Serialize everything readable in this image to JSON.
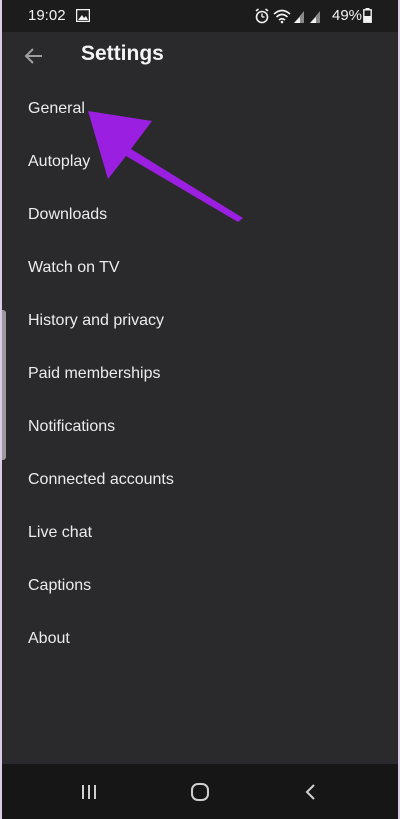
{
  "status_bar": {
    "time": "19:02",
    "battery_percent": "49%",
    "icons": [
      "gallery-icon",
      "alarm-icon",
      "wifi-icon",
      "signal-icon",
      "signal-icon",
      "battery-icon"
    ]
  },
  "app_bar": {
    "title": "Settings",
    "back_icon": "arrow-left-icon"
  },
  "settings": {
    "items": [
      {
        "label": "General"
      },
      {
        "label": "Autoplay"
      },
      {
        "label": "Downloads"
      },
      {
        "label": "Watch on TV"
      },
      {
        "label": "History and privacy"
      },
      {
        "label": "Paid memberships"
      },
      {
        "label": "Notifications"
      },
      {
        "label": "Connected accounts"
      },
      {
        "label": "Live chat"
      },
      {
        "label": "Captions"
      },
      {
        "label": "About"
      }
    ]
  },
  "annotation": {
    "arrow_color": "#9b1fe0",
    "points_to": "General"
  },
  "nav_bar": {
    "icons": [
      "recent-apps-icon",
      "home-icon",
      "back-icon"
    ]
  },
  "colors": {
    "background": "#2a2a2c",
    "status_bar": "#1c1c1d",
    "nav_bar": "#161617",
    "text": "#ececec"
  }
}
